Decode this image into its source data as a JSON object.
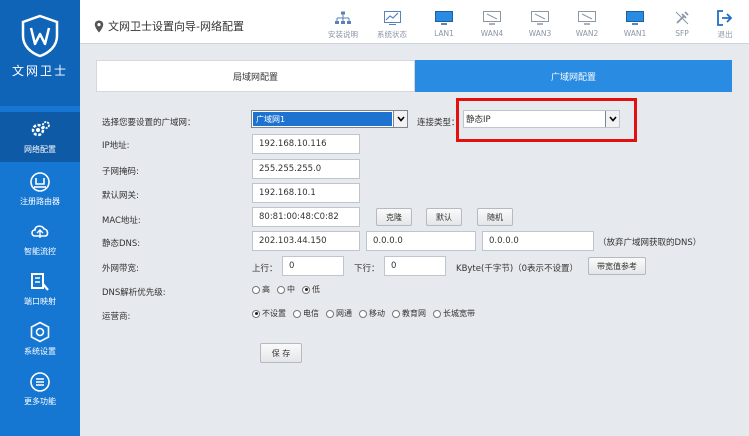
{
  "sidebar": {
    "logo_text": "文网卫士",
    "items": [
      {
        "label": "网络配置",
        "icon": "gear-icon"
      },
      {
        "label": "注册路由器",
        "icon": "router-icon"
      },
      {
        "label": "智能流控",
        "icon": "flow-icon"
      },
      {
        "label": "端口映射",
        "icon": "port-map-icon"
      },
      {
        "label": "系统设置",
        "icon": "settings-icon"
      },
      {
        "label": "更多功能",
        "icon": "menu-icon"
      }
    ]
  },
  "header": {
    "breadcrumb": "文网卫士设置向导-网络配置",
    "tools": [
      {
        "label": "安装说明",
        "icon": "network-icon"
      },
      {
        "label": "系统状态",
        "icon": "chart-icon"
      },
      {
        "label": "LAN1",
        "icon": "monitor-icon"
      },
      {
        "label": "WAN4",
        "icon": "monitor-icon"
      },
      {
        "label": "WAN3",
        "icon": "monitor-icon"
      },
      {
        "label": "WAN2",
        "icon": "monitor-icon"
      },
      {
        "label": "WAN1",
        "icon": "monitor-icon"
      },
      {
        "label": "SFP",
        "icon": "sfp-icon"
      },
      {
        "label": "退出",
        "icon": "exit-icon"
      }
    ]
  },
  "tabs": {
    "lan": "局域网配置",
    "wan": "广域网配置"
  },
  "form": {
    "wan_select_label": "选择您要设置的广域网：",
    "wan_select_value": "广域网1",
    "conn_type_label": "连接类型：",
    "conn_type_value": "静态IP",
    "ip_label": "IP地址:",
    "ip_value": "192.168.10.116",
    "mask_label": "子网掩码:",
    "mask_value": "255.255.255.0",
    "gateway_label": "默认网关:",
    "gateway_value": "192.168.10.1",
    "mac_label": "MAC地址:",
    "mac_value": "80:81:00:48:C0:82",
    "mac_buttons": {
      "clone": "克隆",
      "default": "默认",
      "random": "随机"
    },
    "dns_label": "静态DNS:",
    "dns1": "202.103.44.150",
    "dns2": "0.0.0.0",
    "dns3": "0.0.0.0",
    "dns_note": "（放弃广域网获取的DNS）",
    "bw_label": "外网带宽:",
    "up_label": "上行：",
    "up_value": "0",
    "down_label": "下行：",
    "down_value": "0",
    "bw_unit": "KByte(千字节)（0表示不设置）",
    "bw_ref_button": "带宽值参考",
    "dns_priority_label": "DNS解析优先级:",
    "dns_priority_options": [
      "高",
      "中",
      "低"
    ],
    "dns_priority_selected": "低",
    "isp_label": "运营商:",
    "isp_options": [
      "不设置",
      "电信",
      "网通",
      "移动",
      "教育网",
      "长城宽带"
    ],
    "isp_selected": "不设置",
    "save_button": "保 存"
  },
  "colors": {
    "sidebar": "#1677d2",
    "accent": "#2a8be3",
    "highlight_box": "#e31010"
  }
}
